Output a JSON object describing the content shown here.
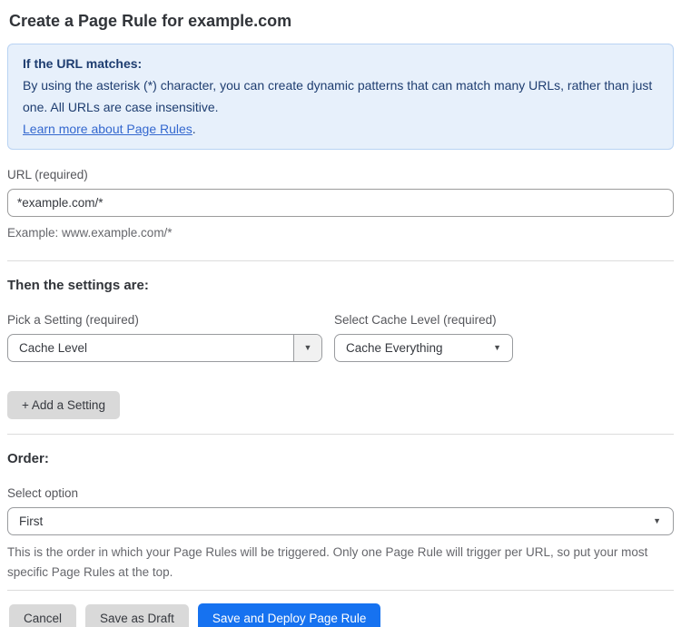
{
  "page": {
    "title": "Create a Page Rule for example.com"
  },
  "info_box": {
    "heading": "If the URL matches:",
    "body": "By using the asterisk (*) character, you can create dynamic patterns that can match many URLs, rather than just one. All URLs are case insensitive.",
    "link_label": "Learn more about Page Rules",
    "link_suffix": "."
  },
  "url_field": {
    "label": "URL (required)",
    "value": "*example.com/*",
    "helper": "Example: www.example.com/*"
  },
  "settings": {
    "heading": "Then the settings are:",
    "setting_select": {
      "label": "Pick a Setting (required)",
      "value": "Cache Level"
    },
    "cache_level_select": {
      "label": "Select Cache Level (required)",
      "value": "Cache Everything"
    },
    "add_setting_label": "+ Add a Setting"
  },
  "order": {
    "heading": "Order:",
    "select_label": "Select option",
    "value": "First",
    "helper": "This is the order in which your Page Rules will be triggered. Only one Page Rule will trigger per URL, so put your most specific Page Rules at the top."
  },
  "actions": {
    "cancel": "Cancel",
    "save_draft": "Save as Draft",
    "save_deploy": "Save and Deploy Page Rule"
  },
  "icons": {
    "dropdown_arrow": "▼"
  },
  "colors": {
    "accent_blue": "#1672f0",
    "info_bg": "#e7f0fb",
    "info_border": "#b9d3f3",
    "info_text": "#1e3d70",
    "link_blue": "#3468cf",
    "button_gray": "#d9d9d9"
  }
}
